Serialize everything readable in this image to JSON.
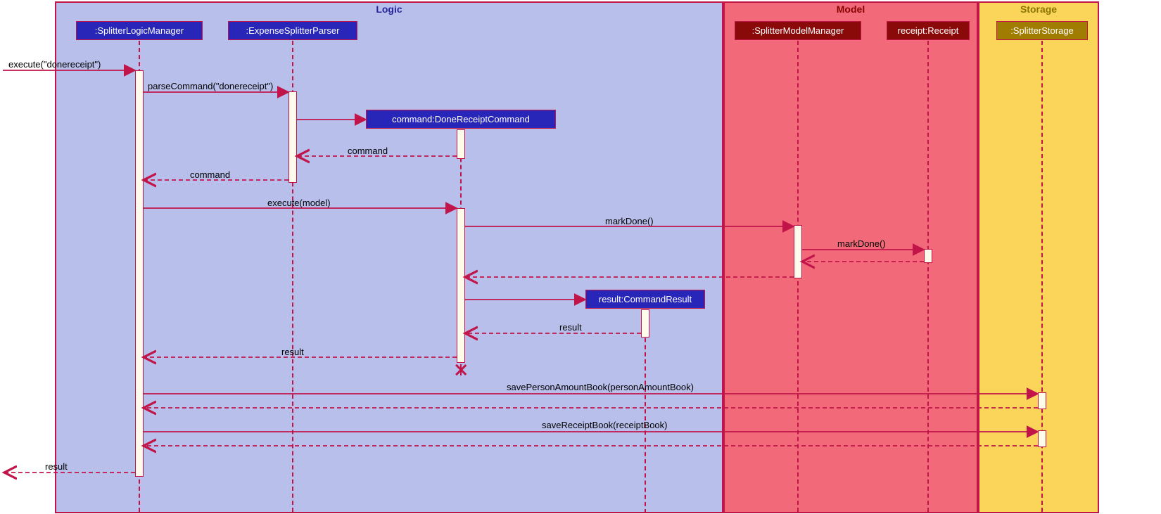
{
  "frames": {
    "logic": "Logic",
    "model": "Model",
    "storage": "Storage"
  },
  "lifelines": {
    "logicMgr": ":SplitterLogicManager",
    "parser": ":ExpenseSplitterParser",
    "cmd": "command:DoneReceiptCommand",
    "result": "result:CommandResult",
    "modelMgr": ":SplitterModelManager",
    "receipt": "receipt:Receipt",
    "storage": ":SplitterStorage"
  },
  "messages": {
    "execute": "execute(\"donereceipt\")",
    "parseCommand": "parseCommand(\"donereceipt\")",
    "commandRet1": "command",
    "commandRet2": "command",
    "executeModel": "execute(model)",
    "markDone1": "markDone()",
    "markDone2": "markDone()",
    "resultRet1": "result",
    "resultRet2": "result",
    "savePAB": "savePersonAmountBook(personAmountBook)",
    "saveRB": "saveReceiptBook(receiptBook)",
    "resultFinal": "result"
  }
}
